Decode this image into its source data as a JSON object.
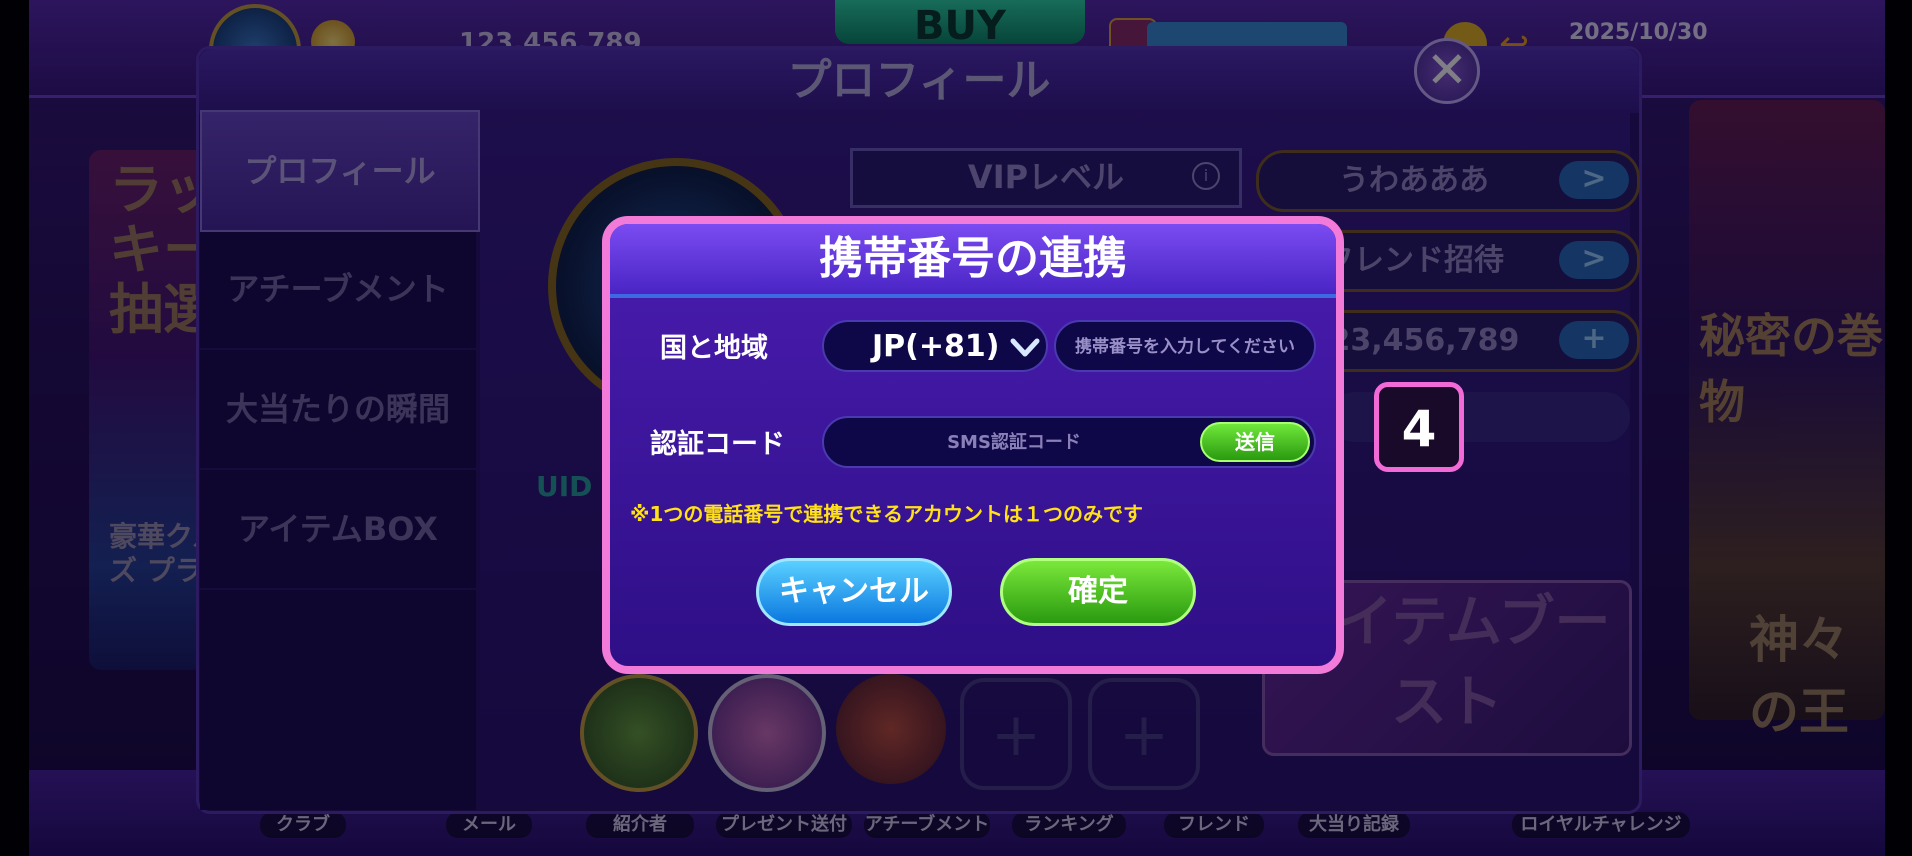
{
  "topbar": {
    "money": "123,456,789",
    "buy_label": "BUY",
    "date": "2025/10/30"
  },
  "banners": {
    "left_title": "ラッキー抽選",
    "left_sub": "豪華クルーズ プライム",
    "right_title": "秘密の巻物",
    "right_sub": "神々の王"
  },
  "profile": {
    "title": "プロフィール",
    "sidebar": [
      {
        "label": "プロフィール",
        "active": true
      },
      {
        "label": "アチーブメント",
        "active": false
      },
      {
        "label": "大当たりの瞬間",
        "active": false
      },
      {
        "label": "アイテムBOX",
        "active": false
      }
    ],
    "vip_label": "VIPレベル",
    "uid_label": "UID",
    "right_rows": [
      {
        "label": "うわあああ",
        "action": ">"
      },
      {
        "label": "フレンド招待",
        "action": ">"
      },
      {
        "label": "123,456,789",
        "action": "+"
      }
    ],
    "item_burst": "アイテムブースト",
    "add_slot": "+"
  },
  "bottom_nav": [
    "クラブ",
    "メール",
    "紹介者",
    "プレゼント送付",
    "アチーブメント",
    "ランキング",
    "フレンド",
    "大当り記録",
    "ロイヤルチャレンジ"
  ],
  "dialog": {
    "title": "携帯番号の連携",
    "region_label": "国と地域",
    "country_value": "JP(+81)",
    "phone_placeholder": "携帯番号を入力してください",
    "code_label": "認証コード",
    "code_placeholder": "SMS認証コード",
    "send_label": "送信",
    "notice": "※1つの電話番号で連携できるアカウントは１つのみです",
    "cancel_label": "キャンセル",
    "confirm_label": "確定"
  },
  "step_badge": "4",
  "colors": {
    "dialog_border": "#f27ad8",
    "notice_text": "#ffe11a",
    "confirm_green": "#2a9a10",
    "cancel_blue": "#0a78e0"
  }
}
